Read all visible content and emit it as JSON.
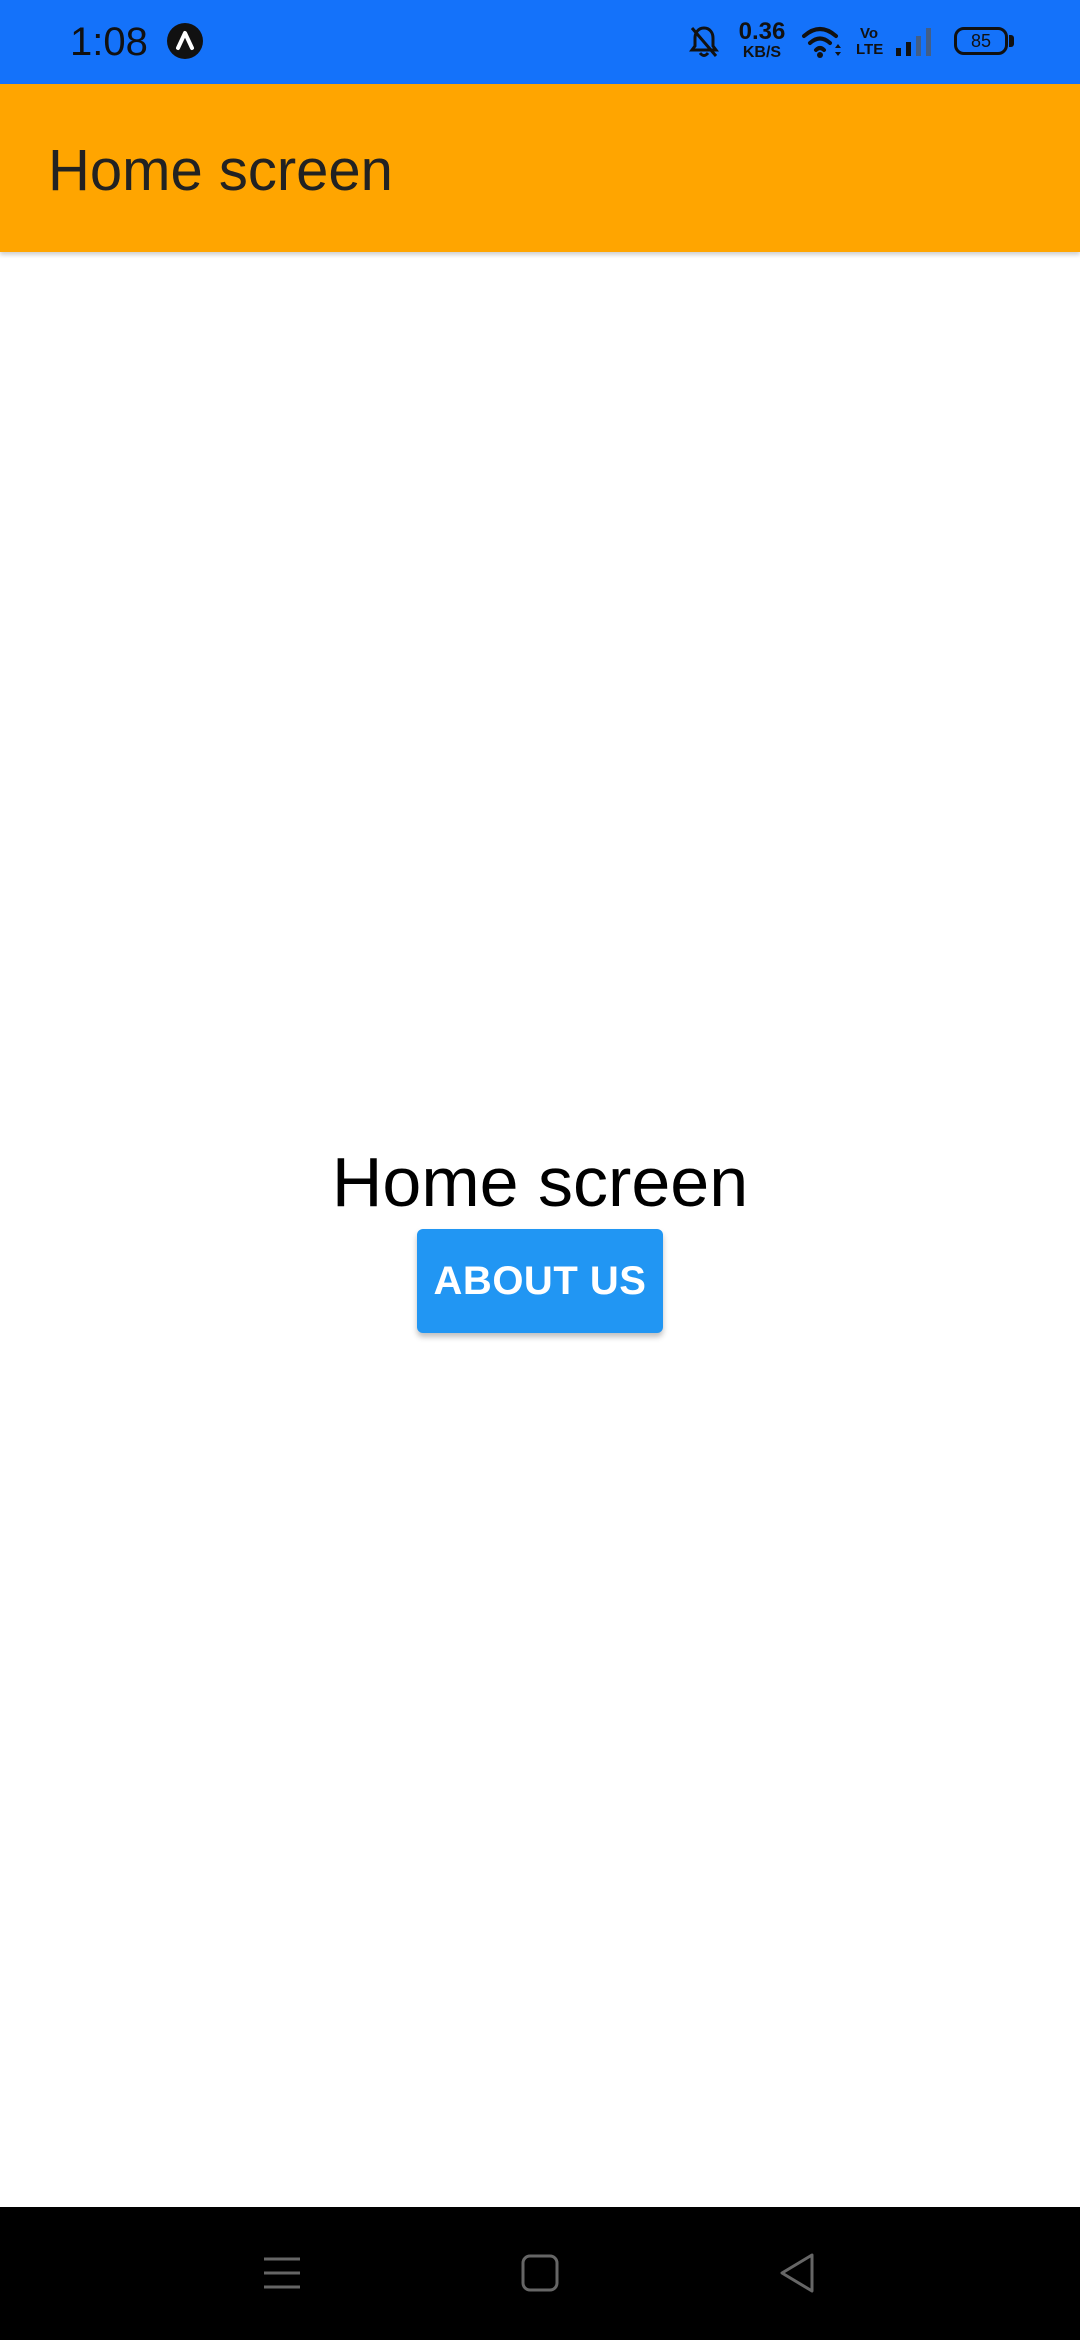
{
  "status_bar": {
    "time": "1:08",
    "net_speed_value": "0.36",
    "net_speed_unit": "KB/S",
    "volte_top": "Vo",
    "volte_bottom": "LTE",
    "battery": "85",
    "background": "#1472FA",
    "icons": [
      "app-notification-icon",
      "mute-bell-icon",
      "wifi-icon",
      "signal-icon",
      "battery-icon"
    ]
  },
  "app_bar": {
    "title": "Home screen",
    "background": "#FFA500"
  },
  "main": {
    "heading": "Home screen",
    "about_button_label": "ABOUT US",
    "button_color": "#2196F3"
  },
  "nav_bar": {
    "icons": [
      "menu-icon",
      "home-icon",
      "back-icon"
    ]
  }
}
